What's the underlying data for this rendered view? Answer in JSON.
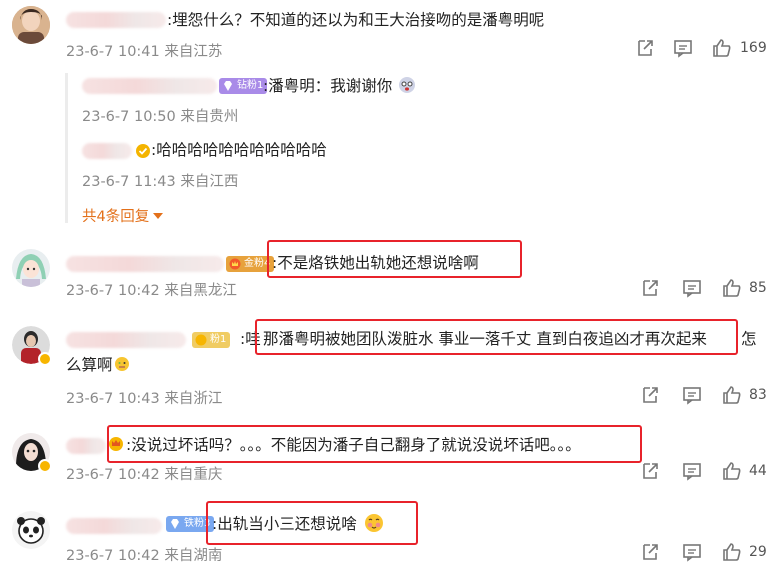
{
  "comments": [
    {
      "text": ":埋怨什么？不知道的还以为和王大治接吻的是潘粤明呢",
      "time": "23-6-7 10:41",
      "location": "来自江苏",
      "likes": "169",
      "replies": [
        {
          "badge": "钻粉1",
          "text": ":潘粤明：我谢谢你",
          "time": "23-6-7 10:50",
          "location": "来自贵州"
        },
        {
          "text": ":哈哈哈哈哈哈哈哈哈哈哈",
          "time": "23-6-7 11:43",
          "location": "来自江西"
        }
      ],
      "more_replies": "共4条回复"
    },
    {
      "badge": "金粉4",
      "text": ":不是烙铁她出轨她还想说啥啊",
      "time": "23-6-7 10:42",
      "location": "来自黑龙江",
      "likes": "85"
    },
    {
      "badge": "粉1",
      "prefix": ":哇",
      "text": "那潘粤明被她团队泼脏水 事业一落千丈 直到白夜追凶才再次起来",
      "text_tail": "怎",
      "text_line2": "么算啊",
      "time": "23-6-7 10:43",
      "location": "来自浙江",
      "likes": "83"
    },
    {
      "text": ":没说过坏话吗？。。。不能因为潘子自己翻身了就说没说坏话吧。。。",
      "time": "23-6-7 10:42",
      "location": "来自重庆",
      "likes": "44"
    },
    {
      "badge": "铁粉3",
      "text": ":出轨当小三还想说啥",
      "time": "23-6-7 10:42",
      "location": "来自湖南",
      "likes": "29"
    }
  ],
  "colors": {
    "highlight_box": "#e8232b",
    "meta_gray": "#8a8a8a",
    "more_link": "#e3701a"
  },
  "icons": [
    "share-icon",
    "comment-icon",
    "like-icon"
  ]
}
